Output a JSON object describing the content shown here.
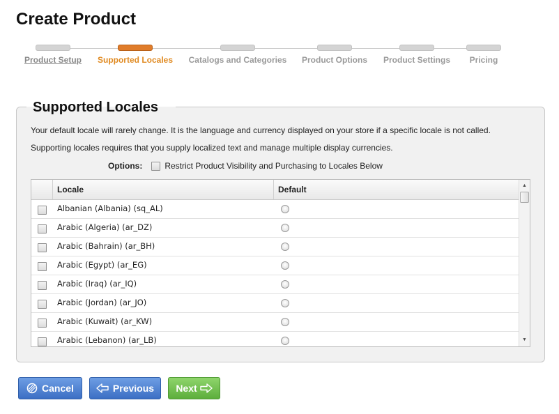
{
  "page": {
    "title": "Create Product"
  },
  "wizard": {
    "steps": [
      {
        "label": "Product Setup",
        "state": "done"
      },
      {
        "label": "Supported Locales",
        "state": "active"
      },
      {
        "label": "Catalogs and Categories",
        "state": "pending"
      },
      {
        "label": "Product Options",
        "state": "pending"
      },
      {
        "label": "Product Settings",
        "state": "pending"
      },
      {
        "label": "Pricing",
        "state": "pending"
      }
    ]
  },
  "panel": {
    "legend": "Supported Locales",
    "description1": "Your default locale will rarely change. It is the language and currency displayed on your store if a specific locale is not called.",
    "description2": "Supporting locales requires that you supply localized text and manage multiple display currencies.",
    "options_label": "Options:",
    "restrict_label": "Restrict Product Visibility and Purchasing to Locales Below",
    "restrict_checked": false
  },
  "grid": {
    "columns": {
      "locale": "Locale",
      "default": "Default"
    },
    "rows": [
      {
        "locale": "Albanian (Albania) (sq_AL)",
        "checked": false,
        "default": false
      },
      {
        "locale": "Arabic (Algeria) (ar_DZ)",
        "checked": false,
        "default": false
      },
      {
        "locale": "Arabic (Bahrain) (ar_BH)",
        "checked": false,
        "default": false
      },
      {
        "locale": "Arabic (Egypt) (ar_EG)",
        "checked": false,
        "default": false
      },
      {
        "locale": "Arabic (Iraq) (ar_IQ)",
        "checked": false,
        "default": false
      },
      {
        "locale": "Arabic (Jordan) (ar_JO)",
        "checked": false,
        "default": false
      },
      {
        "locale": "Arabic (Kuwait) (ar_KW)",
        "checked": false,
        "default": false
      },
      {
        "locale": "Arabic (Lebanon) (ar_LB)",
        "checked": false,
        "default": false
      }
    ]
  },
  "buttons": {
    "cancel": {
      "label": "Cancel",
      "icon": "cancel-circle-icon"
    },
    "previous": {
      "label": "Previous",
      "icon": "arrow-left-icon"
    },
    "next": {
      "label": "Next",
      "icon": "arrow-right-icon"
    }
  },
  "colors": {
    "accent": "#e07c2a",
    "primary_button": "#3c6fc4",
    "next_button": "#5dae3c"
  }
}
